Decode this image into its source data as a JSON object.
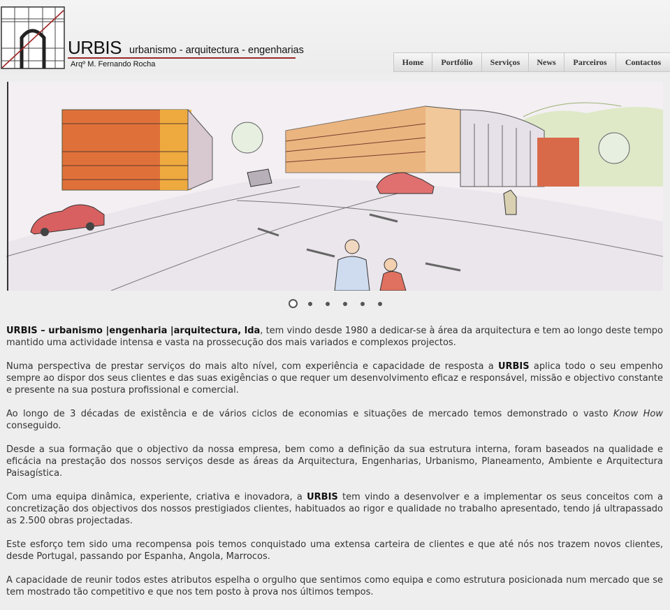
{
  "brand": {
    "name": "URBIS",
    "tagline": "urbanismo - arquitectura - engenharias",
    "author": "Arqº M. Fernando Rocha",
    "accent_color": "#9a2a2a"
  },
  "nav": {
    "items": [
      "Home",
      "Portfólio",
      "Serviços",
      "News",
      "Parceiros",
      "Contactos"
    ]
  },
  "slider": {
    "image_icon": "architectural-sketch-image",
    "dot_count": 6,
    "active_dot": 0
  },
  "content": {
    "p1_strong": "URBIS – urbanismo  |engenharia  |arquitectura, lda",
    "p1_rest": ", tem vindo desde 1980 a dedicar-se à área da arquitectura e tem ao longo deste tempo mantido uma actividade intensa e vasta na prossecução dos mais variados e complexos projectos.",
    "p2_a": "Numa perspectiva de prestar serviços do mais alto nível, com experiência e capacidade de resposta a ",
    "p2_strong": "URBIS",
    "p2_b": " aplica todo o seu empenho sempre ao dispor dos seus clientes e das suas exigências o que requer um desenvolvimento eficaz e responsável, missão e objectivo constante e presente na sua postura profissional e comercial.",
    "p3_a": "Ao longo de 3 décadas de existência e de vários ciclos de economias e situações de mercado temos demonstrado o vasto ",
    "p3_em": "Know How",
    "p3_b": " conseguido.",
    "p4": "Desde a sua formação que o objectivo da nossa empresa, bem como a definição da sua estrutura interna, foram baseados na qualidade e eficácia na prestação dos nossos serviços desde as áreas da Arquitectura, Engenharias, Urbanismo, Planeamento, Ambiente e Arquitectura Paisagística.",
    "p5_a": "Com uma equipa dinâmica, experiente, criativa e inovadora, a ",
    "p5_strong": "URBIS",
    "p5_b": " tem vindo a desenvolver e a implementar os seus conceitos com a concretização dos objectivos dos nossos prestigiados clientes, habituados ao rigor e qualidade no trabalho apresentado, tendo já ultrapassado as 2.500 obras projectadas.",
    "p6": "Este esforço tem sido uma recompensa pois temos conquistado uma extensa carteira de clientes e que até nós nos trazem novos clientes, desde Portugal, passando por Espanha, Angola, Marrocos.",
    "p7": "A capacidade de reunir todos estes atributos espelha o orgulho que sentimos como equipa e como estrutura posicionada num mercado que se tem mostrado tão competitivo e que nos tem posto à prova nos últimos tempos."
  }
}
